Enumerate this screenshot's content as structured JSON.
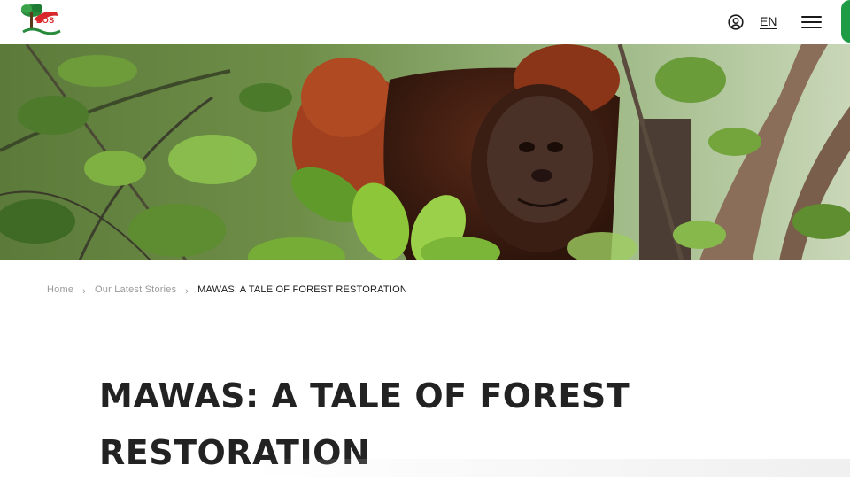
{
  "header": {
    "logo_text": "BOS",
    "language": "EN",
    "account_icon": "user-circle-icon",
    "menu_icon": "hamburger-menu-icon",
    "accent_color": "#1e9c45"
  },
  "hero": {
    "image_description": "orangutan-in-forest"
  },
  "breadcrumb": {
    "items": [
      "Home",
      "Our Latest Stories"
    ],
    "current": "MAWAS: A TALE OF FOREST RESTORATION"
  },
  "article": {
    "title": "MAWAS: A TALE OF FOREST RESTORATION"
  }
}
